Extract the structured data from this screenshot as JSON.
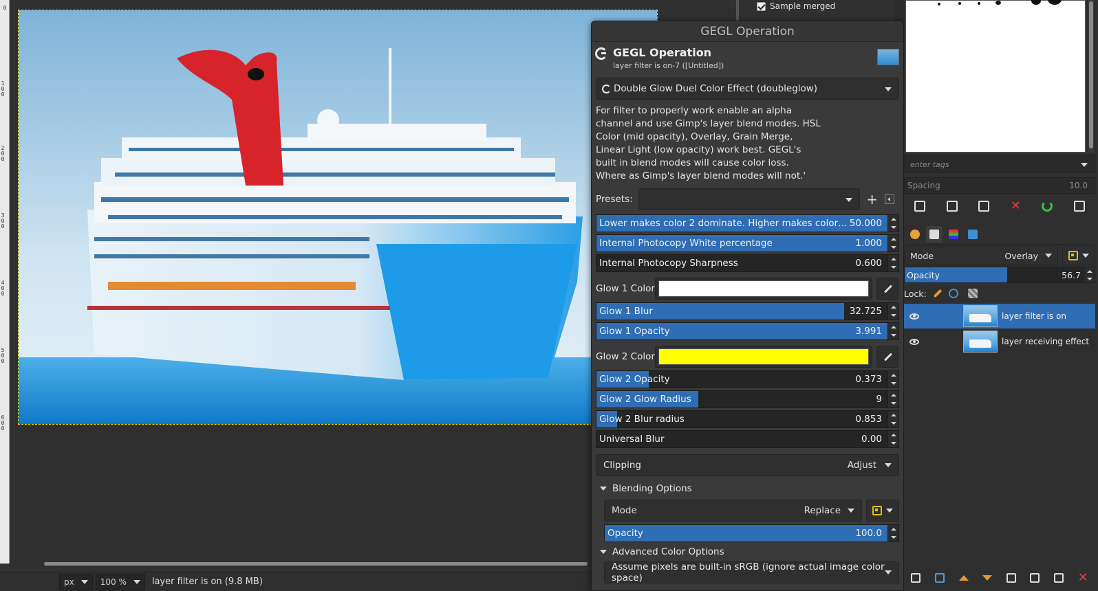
{
  "canvas": {
    "ruler_ticks": [
      "0",
      "1 0 0",
      "2 0 0",
      "3 0 0",
      "4 0 0",
      "5 0 0",
      "6 0 0"
    ]
  },
  "statusbar": {
    "unit": "px",
    "zoom": "100 %",
    "status_text": "layer filter is on (9.8 MB)"
  },
  "tool_options": {
    "sample_merged_label": "Sample merged",
    "sample_merged_checked": true
  },
  "gegl_dialog": {
    "window_title": "GEGL Operation",
    "header_title": "GEGL Operation",
    "header_subtitle": "layer filter is on-7 ([Untitled])",
    "operation": "Double Glow Duel Color Effect (doubleglow)",
    "description": "For filter to properly work enable an alpha channel and use Gimp's layer blend modes. HSL Color (mid opacity),  Overlay, Grain Merge, Linear Light (low opacity) work best. GEGL's built in blend modes will cause color loss. Where as Gimp's layer blend modes will not.'",
    "presets_label": "Presets:",
    "presets_value": "",
    "params": [
      {
        "label": "Lower makes color 2 dominate. Higher makes color 1 domi...",
        "value": "50.000",
        "fill_fraction": 1.0
      },
      {
        "label": "Internal Photocopy White percentage",
        "value": "1.000",
        "fill_fraction": 1.0
      },
      {
        "label": "Internal Photocopy Sharpness",
        "value": "0.600",
        "fill_fraction": 0.0
      }
    ],
    "glow1_color_label": "Glow 1 Color",
    "glow1_color": "#ffffff",
    "glow1_params": [
      {
        "label": "Glow 1 Blur",
        "value": "32.725",
        "fill_fraction": 0.85
      },
      {
        "label": "Glow 1 Opacity",
        "value": "3.991",
        "fill_fraction": 1.0
      }
    ],
    "glow2_color_label": "Glow 2 Color",
    "glow2_color": "#ffff00",
    "glow2_params": [
      {
        "label": "Glow 2 Opacity",
        "value": "0.373",
        "fill_fraction": 0.18
      },
      {
        "label": "Glow 2 Glow Radius",
        "value": "9",
        "fill_fraction": 0.35
      },
      {
        "label": "Glow 2 Blur radius",
        "value": "0.853",
        "fill_fraction": 0.07
      },
      {
        "label": "Universal Blur",
        "value": "0.00",
        "fill_fraction": 0.0
      }
    ],
    "clipping_label": "Clipping",
    "clipping_value": "Adjust",
    "blending_options_label": "Blending Options",
    "blend_mode_label": "Mode",
    "blend_mode_value": "Replace",
    "blend_opacity_label": "Opacity",
    "blend_opacity_value": "100.0",
    "blend_opacity_fraction": 1.0,
    "advanced_color_label": "Advanced Color Options",
    "advanced_color_value": "Assume pixels are built-in sRGB (ignore actual image color space)"
  },
  "right_dock": {
    "tags_placeholder": "enter tags",
    "spacing_label": "Spacing",
    "spacing_value": "10.0",
    "layers_mode_label": "Mode",
    "layers_mode_value": "Overlay",
    "layers_opacity_label": "Opacity",
    "layers_opacity_value": "56.7",
    "layers_opacity_fraction": 0.567,
    "lock_label": "Lock:",
    "layers": [
      {
        "name": "layer filter is on",
        "selected": true
      },
      {
        "name": "layer receiving effect",
        "selected": false
      }
    ]
  },
  "colors": {
    "accent": "#2f6db4",
    "dialog_bg": "#3a3a3a",
    "sea": "#1f82d0",
    "funnel": "#d6242a"
  }
}
